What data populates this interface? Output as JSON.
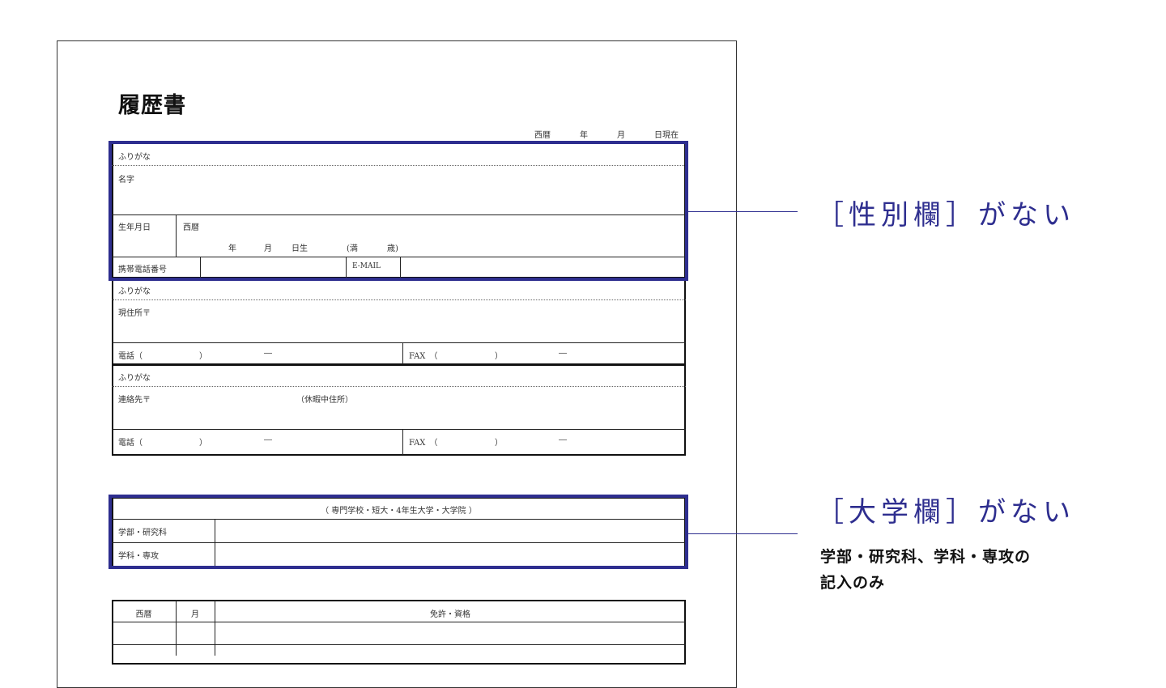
{
  "form": {
    "title": "履歴書",
    "date_line": {
      "era": "西暦",
      "year": "年",
      "month": "月",
      "day": "日現在"
    },
    "personal": {
      "furigana": "ふりがな",
      "name": "名字",
      "birth_label": "生年月日",
      "birth_era": "西暦",
      "birth_year": "年",
      "birth_month": "月",
      "birth_day": "日生",
      "age_open": "(満",
      "age_close": "歳)",
      "mobile": "携帯電話番号",
      "email": "E-MAIL"
    },
    "address": {
      "furigana": "ふりがな",
      "current": "現住所〒",
      "phone": "電話（",
      "phone_close": "）",
      "dash": "―",
      "fax": "FAX　（",
      "fax_close": "）",
      "fax_dash": "―"
    },
    "contact": {
      "furigana": "ふりがな",
      "label": "連絡先〒",
      "vacation": "（休暇中住所）",
      "phone": "電話（",
      "phone_close": "）",
      "dash": "―",
      "fax": "FAX　（",
      "fax_close": "）",
      "fax_dash": "―"
    },
    "school": {
      "header": "（ 専門学校・短大・4年生大学・大学院 ）",
      "faculty": "学部・研究科",
      "department": "学科・専攻"
    },
    "license": {
      "col_year": "西暦",
      "col_month": "月",
      "col_title": "免許・資格"
    }
  },
  "callouts": {
    "gender": "［性別欄］がない",
    "university": "［大学欄］がない",
    "note_line1": "学部・研究科、学科・専攻の",
    "note_line2": "記入のみ"
  },
  "colors": {
    "accent": "#2e2e8f",
    "line": "#222222"
  }
}
